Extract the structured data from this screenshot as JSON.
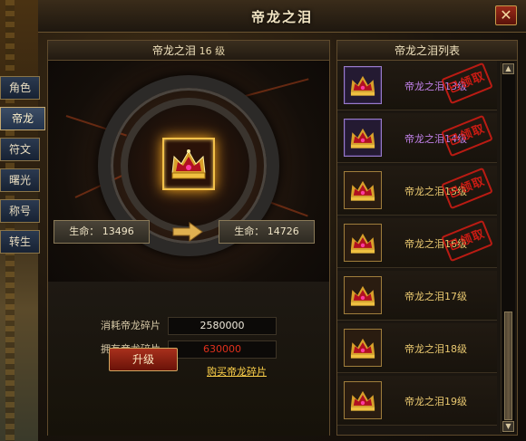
{
  "window": {
    "title": "帝龙之泪",
    "close_label": "✕"
  },
  "tabs": [
    "角色",
    "帝龙",
    "符文",
    "曙光",
    "称号",
    "转生"
  ],
  "active_tab": 1,
  "left_panel": {
    "title": "帝龙之泪",
    "level_label": "16 级",
    "current_stat": {
      "label": "生命：",
      "value": "13496"
    },
    "next_stat": {
      "label": "生命：",
      "value": "14726"
    },
    "cost": {
      "label": "消耗帝龙碎片",
      "value": "2580000"
    },
    "owned": {
      "label": "拥有帝龙碎片",
      "value": "630000"
    },
    "upgrade_label": "升级",
    "buy_link": "购买帝龙碎片"
  },
  "right_panel": {
    "title": "帝龙之泪列表",
    "items": [
      {
        "name": "帝龙之泪13级",
        "stamp": "已领取",
        "quality": "purple"
      },
      {
        "name": "帝龙之泪14级",
        "stamp": "已领取",
        "quality": "purple"
      },
      {
        "name": "帝龙之泪15级",
        "stamp": "已领取",
        "quality": "gold"
      },
      {
        "name": "帝龙之泪16级",
        "stamp": "已领取",
        "quality": "gold"
      },
      {
        "name": "帝龙之泪17级",
        "stamp": "",
        "quality": "gold"
      },
      {
        "name": "帝龙之泪18级",
        "stamp": "",
        "quality": "gold"
      },
      {
        "name": "帝龙之泪19级",
        "stamp": "",
        "quality": "gold"
      }
    ]
  },
  "colors": {
    "stamp": "#e01c14",
    "purple_text": "#c080e8",
    "gold_text": "#e9c870",
    "owned_value": "#e0301c"
  }
}
